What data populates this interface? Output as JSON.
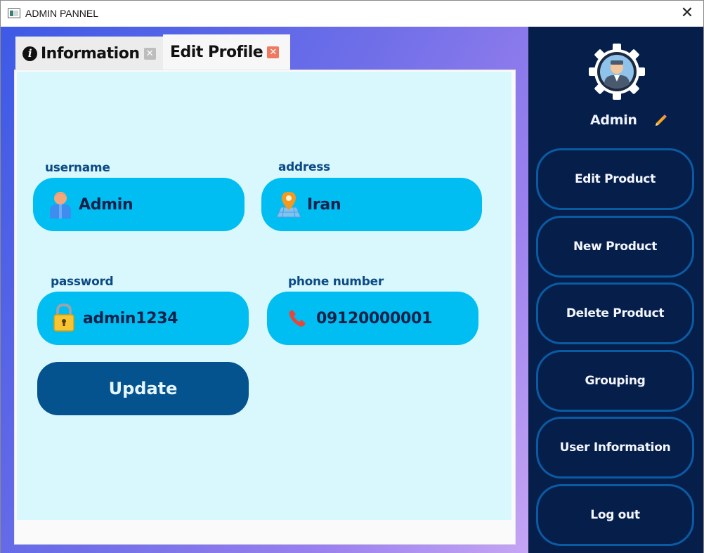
{
  "window": {
    "title": "ADMIN PANNEL",
    "close_glyph": "✕"
  },
  "tabs": [
    {
      "label": "Information",
      "icon": "info-icon",
      "close_glyph": "✕",
      "active": false
    },
    {
      "label": "Edit Profile",
      "close_glyph": "✕",
      "active": true
    }
  ],
  "form": {
    "username": {
      "label": "username",
      "value": "Admin",
      "icon": "user-icon"
    },
    "address": {
      "label": "address",
      "value": "Iran",
      "icon": "map-pin-icon"
    },
    "password": {
      "label": "password",
      "value": "admin1234",
      "icon": "lock-icon"
    },
    "phone": {
      "label": "phone number",
      "value": "09120000001",
      "icon": "phone-icon"
    },
    "update_label": "Update"
  },
  "sidebar": {
    "user_name": "Admin",
    "avatar_icon": "admin-avatar-gear-icon",
    "edit_icon": "pencil-icon",
    "buttons": [
      {
        "label": "Edit Product"
      },
      {
        "label": "New Product"
      },
      {
        "label": "Delete Product"
      },
      {
        "label": "Grouping"
      },
      {
        "label": "User Information"
      },
      {
        "label": "Log out"
      }
    ]
  },
  "colors": {
    "field_bg": "#00bdf2",
    "update_bg": "#04528e",
    "sidebar_bg": "#061e4a",
    "sidebar_btn_border": "#0b5aa4",
    "label_color": "#0c4a86"
  }
}
